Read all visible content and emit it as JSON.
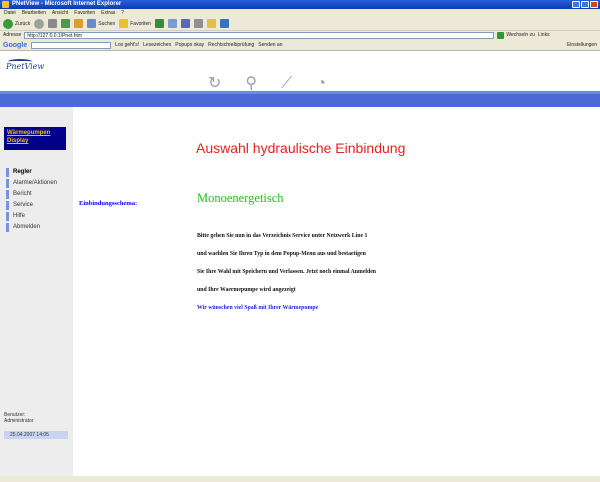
{
  "window": {
    "title": "PNetView - Microsoft Internet Explorer"
  },
  "menubar": [
    "Datei",
    "Bearbeiten",
    "Ansicht",
    "Favoriten",
    "Extras",
    "?"
  ],
  "toolbar": {
    "back_label": "Zurück",
    "search_label": "Suchen",
    "favorites_label": "Favoriten"
  },
  "addressbar": {
    "label": "Adresse",
    "url": "http://127.0.0.1/Pnet.htm",
    "go_label": "Wechseln zu",
    "links_label": "Links"
  },
  "googlebar": {
    "logo": "Google",
    "go_label": "Los geht's!",
    "bookmarks_label": "Lesezeichen",
    "popups_label": "Popups okay",
    "spellcheck_label": "Rechtschreibprüfung",
    "send_label": "Senden an",
    "settings_label": "Einstellungen"
  },
  "app": {
    "logo": "PnetView",
    "nav_icons": [
      "refresh-icon",
      "lightbulb-icon",
      "chart-icon",
      "timer-icon"
    ]
  },
  "sidebar": {
    "wp_display_line1": "Wärmepumpen",
    "wp_display_line2": "Display",
    "items": [
      {
        "label": "Regler",
        "active": true
      },
      {
        "label": "Alarme/Aktionen",
        "active": false
      },
      {
        "label": "Bericht",
        "active": false
      },
      {
        "label": "Service",
        "active": false
      },
      {
        "label": "Hilfe",
        "active": false
      },
      {
        "label": "Abmelden",
        "active": false
      }
    ],
    "user_label": "Benutzer:",
    "user_name": "Administrator",
    "timestamp": "25.04.2007 14:05"
  },
  "main": {
    "title": "Auswahl hydraulische Einbindung",
    "schema_label": "Einbindungsschema:",
    "schema_value": "Monoenergetisch",
    "instructions": [
      "Bitte gehen Sie nun in das Verzeichnis Service unter Netzwerk Line 1",
      "und waehlen Sie Ihren Typ in dem Popup-Menu aus und bestaetigen",
      "Sie Ihre Wahl mit Speichern und Verlassen. Jetzt noch einmal Anmelden",
      "und Ihre Waermepumpe wird angezeigt"
    ],
    "closing": "Wir wünschen viel Spaß mit Ihrer Wärmepumpe"
  },
  "colors": {
    "title_red": "#e8211a",
    "schema_green": "#22c022",
    "link_blue": "#0000ff",
    "band_blue": "#4a6ad8",
    "wp_box_bg": "#00008b",
    "wp_box_text": "#e6c800"
  }
}
